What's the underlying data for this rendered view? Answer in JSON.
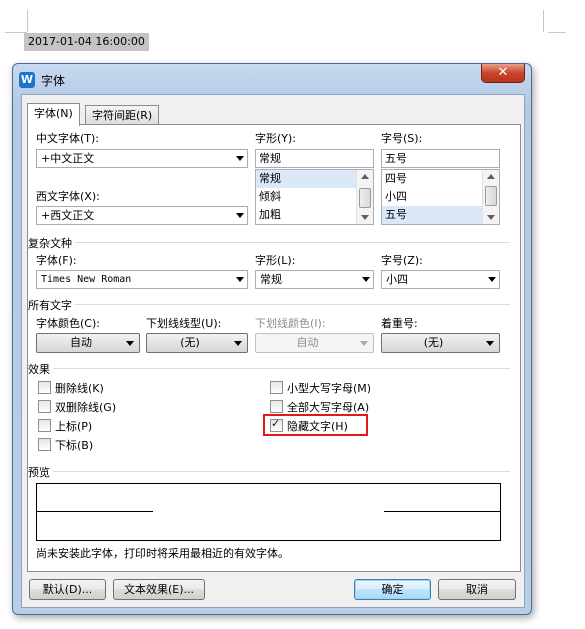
{
  "background_doc": {
    "timestamp": "2017-01-04 16:00:00"
  },
  "dialog": {
    "title": "字体",
    "app_icon_glyph": "W",
    "close_glyph": "✕",
    "tabs": [
      {
        "label": "字体(N)",
        "active": true
      },
      {
        "label": "字符间距(R)",
        "active": false
      }
    ],
    "chinese_font": {
      "label": "中文字体(T):",
      "value": "+中文正文"
    },
    "style": {
      "label": "字形(Y):",
      "value": "常规",
      "list": [
        "常规",
        "倾斜",
        "加粗"
      ],
      "selected": "常规"
    },
    "size": {
      "label": "字号(S):",
      "value": "五号",
      "list": [
        "四号",
        "小四",
        "五号"
      ],
      "selected": "五号"
    },
    "western_font": {
      "label": "西文字体(X):",
      "value": "+西文正文"
    },
    "complex": {
      "section": "复杂文种",
      "font_label": "字体(F):",
      "font_value": "Times New Roman",
      "style_label": "字形(L):",
      "style_value": "常规",
      "size_label": "字号(Z):",
      "size_value": "小四"
    },
    "all_text": {
      "section": "所有文字",
      "font_color_label": "字体颜色(C):",
      "font_color_value": "自动",
      "underline_type_label": "下划线线型(U):",
      "underline_type_value": "(无)",
      "underline_color_label": "下划线颜色(I):",
      "underline_color_value": "自动",
      "emphasis_label": "着重号:",
      "emphasis_value": "(无)"
    },
    "effects": {
      "section": "效果",
      "items": [
        {
          "label": "删除线(K)",
          "checked": false
        },
        {
          "label": "双删除线(G)",
          "checked": false
        },
        {
          "label": "上标(P)",
          "checked": false
        },
        {
          "label": "下标(B)",
          "checked": false
        },
        {
          "label": "小型大写字母(M)",
          "checked": false
        },
        {
          "label": "全部大写字母(A)",
          "checked": false
        },
        {
          "label": "隐藏文字(H)",
          "checked": true
        }
      ],
      "highlight_color": "#e0191c"
    },
    "preview": {
      "section": "预览",
      "note": "尚未安装此字体，打印时将采用最相近的有效字体。"
    },
    "buttons": {
      "default_label": "默认(D)...",
      "text_effect_label": "文本效果(E)...",
      "ok_label": "确定",
      "cancel_label": "取消"
    }
  }
}
